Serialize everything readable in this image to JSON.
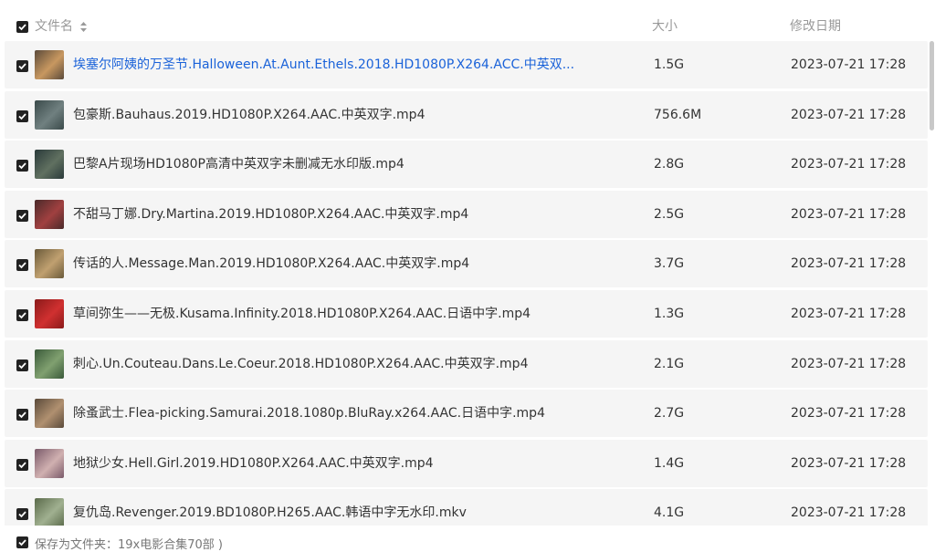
{
  "header": {
    "name_label": "文件名",
    "size_label": "大小",
    "date_label": "修改日期"
  },
  "files": [
    {
      "name": "埃塞尔阿姨的万圣节.Halloween.At.Aunt.Ethels.2018.HD1080P.X264.ACC.中英双...",
      "size": "1.5G",
      "date": "2023-07-21 17:28",
      "thumb_colors": [
        "#5b4a3a",
        "#c89860"
      ]
    },
    {
      "name": "包豪斯.Bauhaus.2019.HD1080P.X264.AAC.中英双字.mp4",
      "size": "756.6M",
      "date": "2023-07-21 17:28",
      "thumb_colors": [
        "#3a4a4a",
        "#708080"
      ]
    },
    {
      "name": "巴黎A片现场HD1080P高清中英双字未删减无水印版.mp4",
      "size": "2.8G",
      "date": "2023-07-21 17:28",
      "thumb_colors": [
        "#2a3a3a",
        "#607060"
      ]
    },
    {
      "name": "不甜马丁娜.Dry.Martina.2019.HD1080P.X264.AAC.中英双字.mp4",
      "size": "2.5G",
      "date": "2023-07-21 17:28",
      "thumb_colors": [
        "#4a2a2a",
        "#a04040"
      ]
    },
    {
      "name": "传话的人.Message.Man.2019.HD1080P.X264.AAC.中英双字.mp4",
      "size": "3.7G",
      "date": "2023-07-21 17:28",
      "thumb_colors": [
        "#6a5a3a",
        "#c0a070"
      ]
    },
    {
      "name": "草间弥生——无极.Kusama.Infinity.2018.HD1080P.X264.AAC.日语中字.mp4",
      "size": "1.3G",
      "date": "2023-07-21 17:28",
      "thumb_colors": [
        "#8a1a1a",
        "#d03030"
      ]
    },
    {
      "name": "刺心.Un.Couteau.Dans.Le.Coeur.2018.HD1080P.X264.AAC.中英双字.mp4",
      "size": "2.1G",
      "date": "2023-07-21 17:28",
      "thumb_colors": [
        "#3a5a3a",
        "#80a070"
      ]
    },
    {
      "name": "除蚤武士.Flea-picking.Samurai.2018.1080p.BluRay.x264.AAC.日语中字.mp4",
      "size": "2.7G",
      "date": "2023-07-21 17:28",
      "thumb_colors": [
        "#5a4a3a",
        "#b09070"
      ]
    },
    {
      "name": "地狱少女.Hell.Girl.2019.HD1080P.X264.AAC.中英双字.mp4",
      "size": "1.4G",
      "date": "2023-07-21 17:28",
      "thumb_colors": [
        "#7a5a6a",
        "#d0b0b0"
      ]
    },
    {
      "name": "复仇岛.Revenger.2019.BD1080P.H265.AAC.韩语中字无水印.mkv",
      "size": "4.1G",
      "date": "2023-07-21 17:28",
      "thumb_colors": [
        "#5a6a4a",
        "#a0b090"
      ]
    }
  ],
  "footer": {
    "save_label": "保存为文件夹：19x电影合集70部 )"
  }
}
